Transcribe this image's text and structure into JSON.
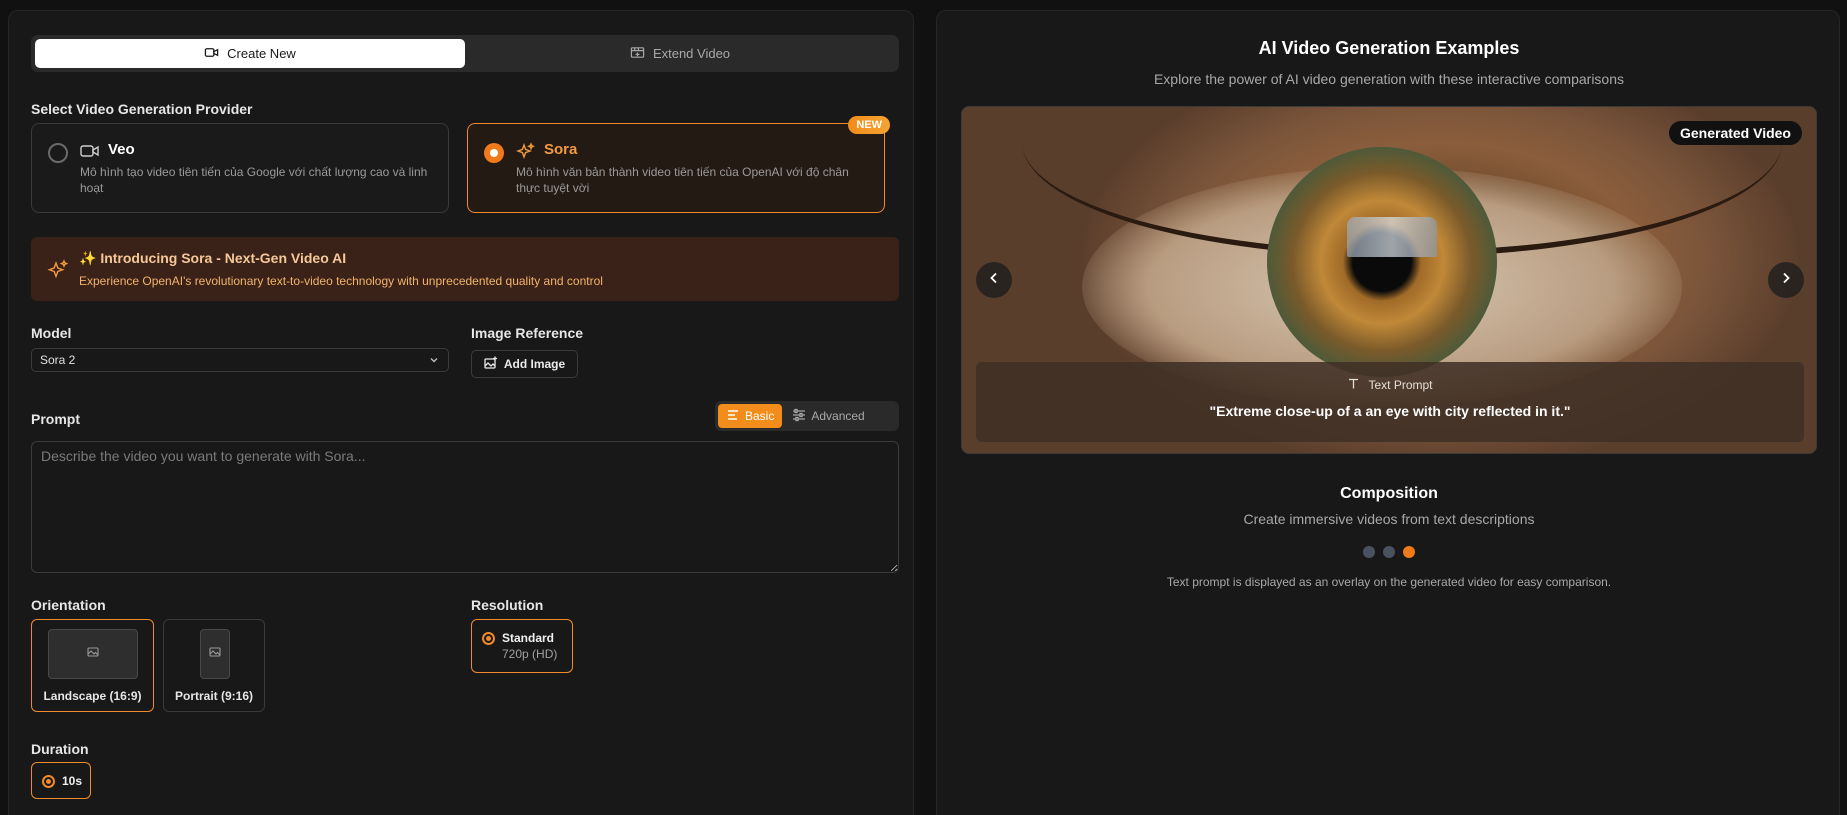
{
  "tabs": [
    {
      "label": "Create New",
      "icon": "video-icon",
      "active": true
    },
    {
      "label": "Extend Video",
      "icon": "film-plus-icon",
      "active": false
    }
  ],
  "provider": {
    "label": "Select Video Generation Provider",
    "options": [
      {
        "title": "Veo",
        "icon": "video-icon",
        "desc": "Mô hình tạo video tiên tiến của Google với chất lượng cao và linh hoạt",
        "selected": false
      },
      {
        "title": "Sora",
        "icon": "sparkles-icon",
        "desc": "Mô hình văn bản thành video tiên tiến của OpenAI với độ chân thực tuyệt vời",
        "selected": true,
        "badge": "NEW"
      }
    ]
  },
  "banner": {
    "title": "✨ Introducing Sora - Next-Gen Video AI",
    "desc": "Experience OpenAI's revolutionary text-to-video technology with unprecedented quality and control"
  },
  "model": {
    "label": "Model",
    "value": "Sora 2"
  },
  "image_ref": {
    "label": "Image Reference",
    "button": "Add Image"
  },
  "prompt": {
    "label": "Prompt",
    "placeholder": "Describe the video you want to generate with Sora...",
    "modes": [
      {
        "label": "Basic",
        "active": true
      },
      {
        "label": "Advanced",
        "active": false
      }
    ]
  },
  "orientation": {
    "label": "Orientation",
    "options": [
      {
        "label": "Landscape (16:9)",
        "selected": true
      },
      {
        "label": "Portrait (9:16)",
        "selected": false
      }
    ]
  },
  "resolution": {
    "label": "Resolution",
    "title": "Standard",
    "sub": "720p (HD)"
  },
  "duration": {
    "label": "Duration",
    "value": "10s"
  },
  "examples": {
    "title": "AI Video Generation Examples",
    "subtitle": "Explore the power of AI video generation with these interactive comparisons",
    "badge": "Generated Video",
    "overlay_label": "Text Prompt",
    "overlay_text": "\"Extreme close-up of a an eye with city reflected in it.\"",
    "comp_title": "Composition",
    "comp_sub": "Create immersive videos from text descriptions",
    "dots": 3,
    "active_dot": 3,
    "caption": "Text prompt is displayed as an overlay on the generated video for easy comparison."
  },
  "colors": {
    "accent": "#f08a2a",
    "bg": "#111111",
    "panel": "#181818"
  }
}
